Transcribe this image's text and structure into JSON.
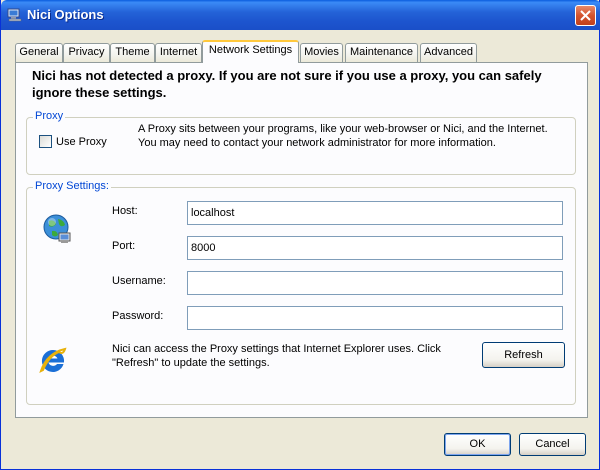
{
  "window": {
    "title": "Nici Options"
  },
  "tabs": [
    {
      "label": "General"
    },
    {
      "label": "Privacy"
    },
    {
      "label": "Theme"
    },
    {
      "label": "Internet"
    },
    {
      "label": "Network Settings"
    },
    {
      "label": "Movies"
    },
    {
      "label": "Maintenance"
    },
    {
      "label": "Advanced"
    }
  ],
  "notice": "Nici has not detected a proxy. If you are not sure if you use a proxy, you can safely ignore these settings.",
  "proxy_group": {
    "legend": "Proxy",
    "use_proxy_label": "Use Proxy",
    "use_proxy_checked": false,
    "description": "A Proxy sits between your programs, like your web-browser or Nici, and the Internet. You may need to contact your network administrator for more information."
  },
  "settings_group": {
    "legend": "Proxy Settings:",
    "host_label": "Host:",
    "host_value": "localhost",
    "port_label": "Port:",
    "port_value": "8000",
    "username_label": "Username:",
    "username_value": "",
    "password_label": "Password:",
    "password_value": "",
    "ie_note": "Nici can access the Proxy settings that Internet Explorer uses. Click \"Refresh\" to update the settings.",
    "refresh_label": "Refresh"
  },
  "buttons": {
    "ok": "OK",
    "cancel": "Cancel"
  },
  "colors": {
    "titlebar": "#1d55cf",
    "legend_text": "#0046d5",
    "active_tab_accent": "#ffc83c"
  },
  "icons": {
    "window": "network-app-icon",
    "globe": "globe-network-icon",
    "ie": "internet-explorer-icon",
    "close": "close-icon"
  }
}
